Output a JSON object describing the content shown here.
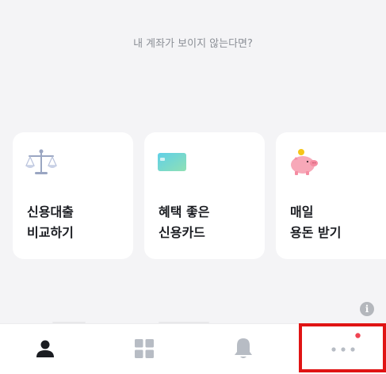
{
  "notice": {
    "text": "내 계좌가 보이지 않는다면?"
  },
  "cards": [
    {
      "line1": "신용대출",
      "line2": "비교하기",
      "icon": "balance-scale-icon"
    },
    {
      "line1": "혜택 좋은",
      "line2": "신용카드",
      "icon": "credit-card-icon"
    },
    {
      "line1": "매일",
      "line2": "용돈 받기",
      "icon": "piggy-bank-icon"
    }
  ],
  "tabbar": {
    "tabs": [
      {
        "icon": "person-icon",
        "active": true
      },
      {
        "icon": "grid-icon",
        "active": false
      },
      {
        "icon": "bell-icon",
        "active": false
      },
      {
        "icon": "more-dots-icon",
        "active": false,
        "badge": true
      }
    ]
  },
  "info": {
    "glyph": "i"
  },
  "colors": {
    "background": "#f4f4f6",
    "card": "#ffffff",
    "active_icon": "#1b1d22",
    "inactive_icon": "#b7bcc4",
    "badge": "#f04452",
    "highlight": "#e01414"
  }
}
